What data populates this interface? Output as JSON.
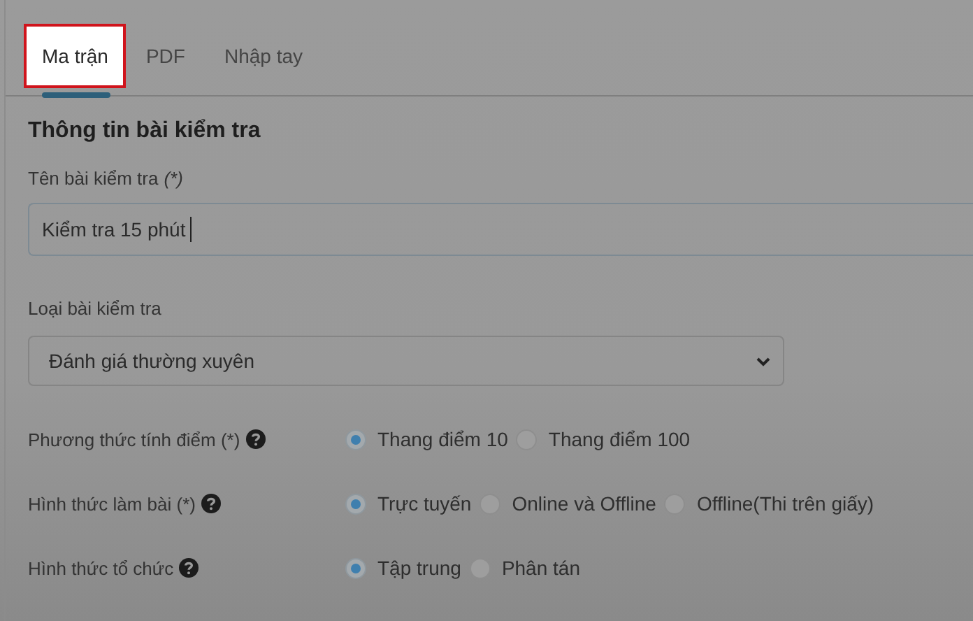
{
  "tabs": [
    {
      "label": "Ma trận",
      "selected": true,
      "highlighted": true
    },
    {
      "label": "PDF",
      "selected": false,
      "highlighted": false
    },
    {
      "label": "Nhập tay",
      "selected": false,
      "highlighted": false
    }
  ],
  "section_title": "Thông tin bài kiểm tra",
  "name_field": {
    "label": "Tên bài kiểm tra",
    "required_note": "(*)",
    "value": "Kiểm tra 15 phút",
    "focused": true
  },
  "type_field": {
    "label": "Loại bài kiểm tra",
    "value": "Đánh giá thường xuyên"
  },
  "radio_groups": [
    {
      "label": "Phương thức tính điểm (*)",
      "options": [
        {
          "label": "Thang điểm 10",
          "selected": true
        },
        {
          "label": "Thang điểm 100",
          "selected": false
        }
      ]
    },
    {
      "label": "Hình thức làm bài (*)",
      "options": [
        {
          "label": "Trực tuyến",
          "selected": true
        },
        {
          "label": "Online và Offline",
          "selected": false
        },
        {
          "label": "Offline(Thi trên giấy)",
          "selected": false
        }
      ]
    },
    {
      "label": "Hình thức tổ chức",
      "options": [
        {
          "label": "Tập trung",
          "selected": true
        },
        {
          "label": "Phân tán",
          "selected": false
        }
      ]
    }
  ]
}
